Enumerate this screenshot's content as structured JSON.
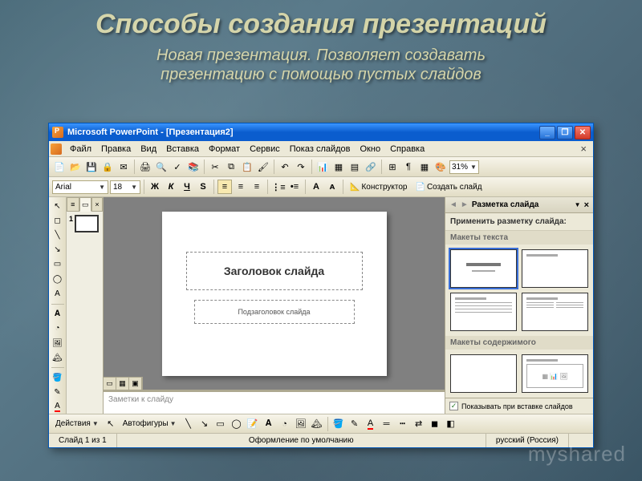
{
  "presentation": {
    "title": "Способы создания презентаций",
    "subtitle_line1": "Новая презентация. Позволяет создавать",
    "subtitle_line2": "презентацию с помощью пустых слайдов"
  },
  "app": {
    "title": "Microsoft PowerPoint - [Презентация2]",
    "menu": [
      "Файл",
      "Правка",
      "Вид",
      "Вставка",
      "Формат",
      "Сервис",
      "Показ слайдов",
      "Окно",
      "Справка"
    ],
    "zoom": "31%",
    "font": "Arial",
    "fontSize": "18",
    "formatButtons": {
      "bold": "Ж",
      "italic": "К",
      "underline": "Ч",
      "strike": "S"
    },
    "designer": "Конструктор",
    "newSlide": "Создать слайд"
  },
  "slide": {
    "number": "1",
    "titlePlaceholder": "Заголовок слайда",
    "subtitlePlaceholder": "Подзаголовок слайда",
    "notesPlaceholder": "Заметки к слайду"
  },
  "taskPane": {
    "title": "Разметка слайда",
    "instruction": "Применить разметку слайда:",
    "section1": "Макеты текста",
    "section2": "Макеты содержимого",
    "showOnInsert": "Показывать при вставке слайдов"
  },
  "drawBar": {
    "actions": "Действия",
    "autoshapes": "Автофигуры"
  },
  "status": {
    "slide": "Слайд 1 из 1",
    "design": "Оформление по умолчанию",
    "lang": "русский (Россия)"
  },
  "watermark": "myshared"
}
